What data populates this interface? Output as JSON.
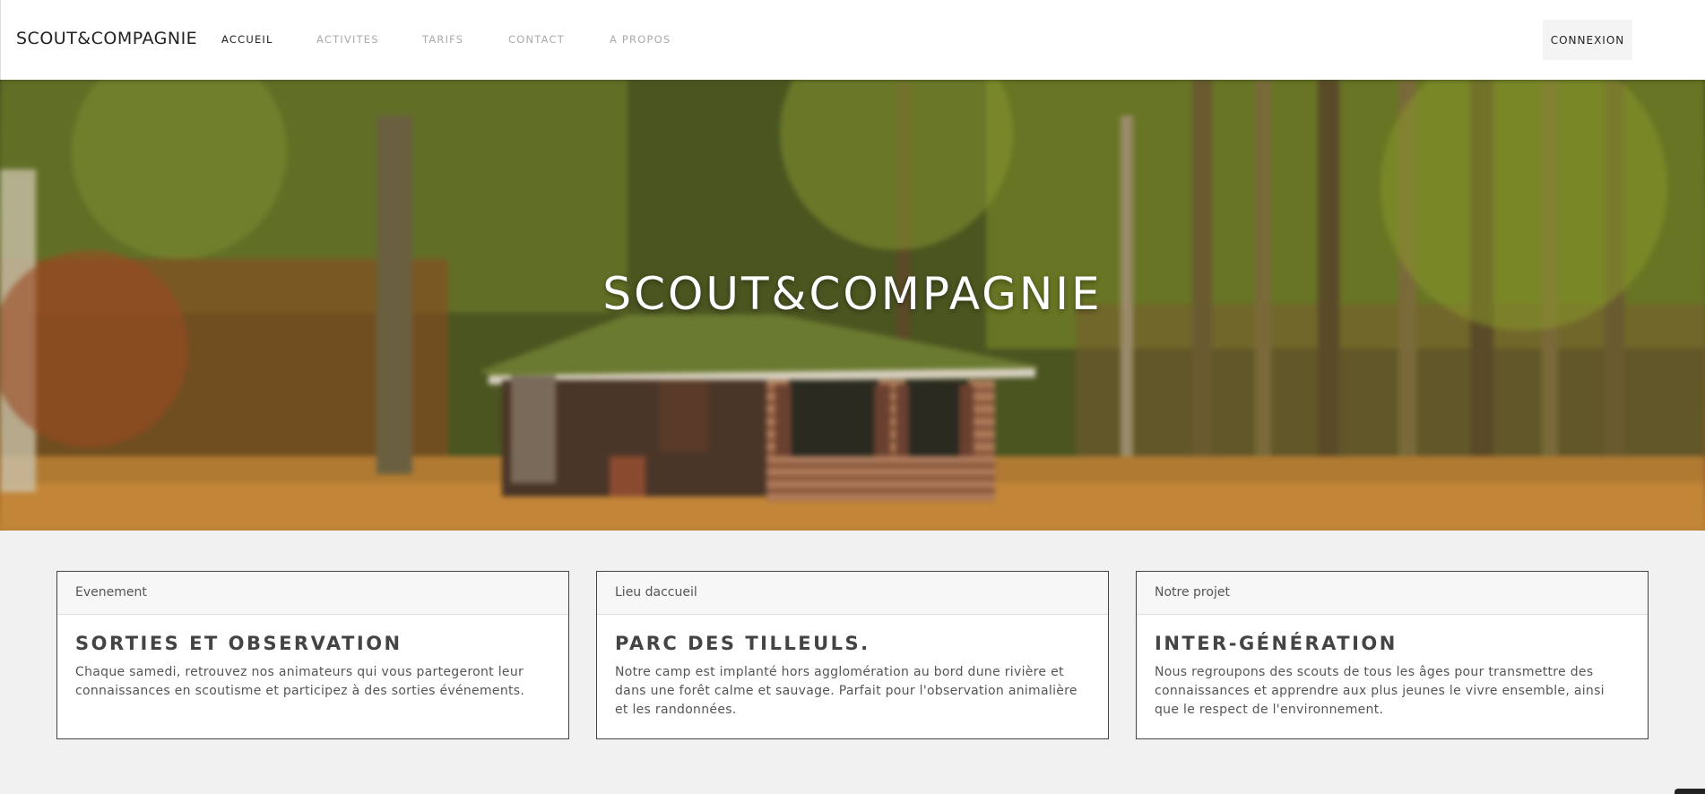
{
  "brand": "SCOUT&COMPAGNIE",
  "nav": {
    "items": [
      {
        "label": "ACCUEIL",
        "active": true
      },
      {
        "label": "ACTIVITES",
        "active": false
      },
      {
        "label": "TARIFS",
        "active": false
      },
      {
        "label": "CONTACT",
        "active": false
      },
      {
        "label": "A PROPOS",
        "active": false
      }
    ],
    "login_label": "CONNEXION"
  },
  "hero": {
    "title": "SCOUT&COMPAGNIE"
  },
  "cards": [
    {
      "header": "Evenement",
      "title": "SORTIES ET OBSERVATION",
      "text": "Chaque samedi, retrouvez nos animateurs qui vous partegeront leur connaissances en scoutisme et participez à des sorties événements."
    },
    {
      "header": "Lieu daccueil",
      "title": "PARC DES TILLEULS.",
      "text": "Notre camp est implanté hors agglomération au bord dune rivière et dans une forêt calme et sauvage. Parfait pour l'observation animalière et les randonnées."
    },
    {
      "header": "Notre projet",
      "title": "INTER-GÉNÉRATION",
      "text": "Nous regroupons des scouts de tous les âges pour transmettre des connaissances et apprendre aux plus jeunes le vivre ensemble, ainsi que le respect de l'environnement."
    }
  ]
}
